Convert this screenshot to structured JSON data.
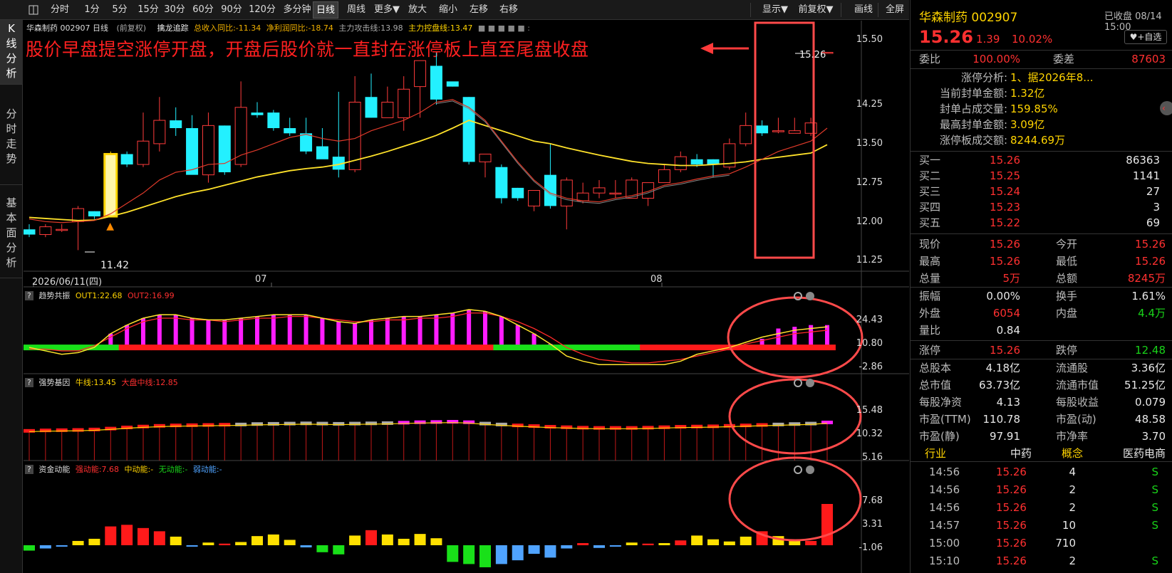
{
  "toolbar": {
    "items": [
      "分时",
      "1分",
      "5分",
      "15分",
      "30分",
      "60分",
      "90分",
      "120分",
      "多分钟",
      "日线",
      "周线",
      "更多▼",
      "放大",
      "缩小",
      "左移",
      "右移"
    ],
    "display": "显示▼",
    "adjust": "前复权▼",
    "draw": "画线",
    "fullscreen": "全屏"
  },
  "sidebar": {
    "tabs": [
      "K\n线\n分\n析",
      "分\n时\n走\n势",
      "基\n本\n面\n分\n析"
    ]
  },
  "main": {
    "header": {
      "title": "华森制药 002907 日线",
      "adj": "(前复权)",
      "indicator": "擒龙追踪",
      "income": "总收入同比:-11.34",
      "profit": "净利润同比:-18.74",
      "attack": "主力攻击线:13.98",
      "control": "主力控盘线:13.47",
      "dots": "■ ■ ■ ■ ■ :"
    },
    "annotation": "股价早盘提空涨停开盘，开盘后股价就一直封在涨停板上直至尾盘收盘",
    "last_price_label": "15.26",
    "low_label": "11.42",
    "yaxis": [
      "15.50",
      "14.25",
      "13.50",
      "12.75",
      "12.00",
      "11.25"
    ],
    "dates": [
      "2026/06/11(四)",
      "07",
      "08"
    ]
  },
  "panels": [
    {
      "q": "?",
      "name": "趋势共振",
      "l1": "OUT1:22.68",
      "l2": "OUT2:16.99",
      "yaxis": [
        "24.43",
        "10.80",
        "-2.86"
      ]
    },
    {
      "q": "?",
      "name": "强势基因",
      "l1": "牛线:13.45",
      "l2": "大盘中线:12.85",
      "yaxis": [
        "15.48",
        "10.32",
        "5.16"
      ]
    },
    {
      "q": "?",
      "name": "资金动能",
      "l1": "强动能:7.68",
      "l2": "中动能:-",
      "l3": "无动能:-",
      "l4": "弱动能:-",
      "yaxis": [
        "7.68",
        "3.31",
        "-1.06"
      ]
    }
  ],
  "right": {
    "name": "华森制药 002907",
    "status": "已收盘 08/14 15:00",
    "price": "15.26",
    "change": "1.39",
    "pct": "10.02%",
    "fav": "+自选",
    "ratio": {
      "l": "委比",
      "v": "100.00%",
      "l2": "委差",
      "v2": "87603"
    },
    "limit": [
      {
        "k": "涨停分析:",
        "v": "1、据2026年8..."
      },
      {
        "k": "当前封单金额:",
        "v": "1.32亿"
      },
      {
        "k": "封单占成交量:",
        "v": "159.85%"
      },
      {
        "k": "最高封单金额:",
        "v": "3.09亿"
      },
      {
        "k": "涨停板成交额:",
        "v": "8244.69万"
      }
    ],
    "bids": [
      {
        "l": "买一",
        "p": "15.26",
        "v": "86363"
      },
      {
        "l": "买二",
        "p": "15.25",
        "v": "1141"
      },
      {
        "l": "买三",
        "p": "15.24",
        "v": "27"
      },
      {
        "l": "买四",
        "p": "15.23",
        "v": "3"
      },
      {
        "l": "买五",
        "p": "15.22",
        "v": "69"
      }
    ],
    "stats1": [
      {
        "a": "现价",
        "b": "15.26",
        "c": "今开",
        "d": "15.26"
      },
      {
        "a": "最高",
        "b": "15.26",
        "c": "最低",
        "d": "15.26"
      },
      {
        "a": "总量",
        "b": "5万",
        "c": "总额",
        "d": "8245万"
      }
    ],
    "stats2": [
      {
        "a": "振幅",
        "b": "0.00%",
        "c": "换手",
        "d": "1.61%"
      },
      {
        "a": "外盘",
        "b": "6054",
        "c": "内盘",
        "d": "4.4万"
      },
      {
        "a": "量比",
        "b": "0.84",
        "c": "",
        "d": ""
      }
    ],
    "stats3": [
      {
        "a": "涨停",
        "b": "15.26",
        "c": "跌停",
        "d": "12.48"
      }
    ],
    "stats4": [
      {
        "a": "总股本",
        "b": "4.18亿",
        "c": "流通股",
        "d": "3.36亿"
      },
      {
        "a": "总市值",
        "b": "63.73亿",
        "c": "流通市值",
        "d": "51.25亿"
      },
      {
        "a": "每股净资",
        "b": "4.13",
        "c": "每股收益",
        "d": "0.079"
      },
      {
        "a": "市盈(TTM)",
        "b": "110.78",
        "c": "市盈(动)",
        "d": "48.58"
      },
      {
        "a": "市盈(静)",
        "b": "97.91",
        "c": "市净率",
        "d": "3.70"
      }
    ],
    "industry": {
      "a": "行业",
      "b": "中药",
      "c": "概念",
      "d": "医药电商"
    },
    "ticks": [
      {
        "t": "14:56",
        "p": "15.26",
        "v": "4",
        "s": "S"
      },
      {
        "t": "14:56",
        "p": "15.26",
        "v": "2",
        "s": "S"
      },
      {
        "t": "14:56",
        "p": "15.26",
        "v": "2",
        "s": "S"
      },
      {
        "t": "14:57",
        "p": "15.26",
        "v": "10",
        "s": "S"
      },
      {
        "t": "15:00",
        "p": "15.26",
        "v": "710",
        "s": ""
      },
      {
        "t": "15:10",
        "p": "15.26",
        "v": "2",
        "s": "S"
      }
    ]
  },
  "chart_data": {
    "type": "candlestick",
    "symbol": "华森制药 002907",
    "ohlc": [
      [
        11.85,
        11.95,
        11.7,
        11.75
      ],
      [
        11.75,
        11.95,
        11.7,
        11.9
      ],
      [
        11.85,
        11.95,
        11.8,
        11.85
      ],
      [
        12.0,
        12.3,
        11.45,
        12.25
      ],
      [
        12.2,
        12.2,
        12.05,
        12.1
      ],
      [
        12.1,
        13.35,
        12.1,
        13.3
      ],
      [
        13.3,
        13.35,
        13.05,
        13.1
      ],
      [
        13.1,
        14.1,
        13.05,
        13.55
      ],
      [
        13.5,
        14.4,
        13.35,
        13.95
      ],
      [
        13.95,
        14.2,
        13.65,
        13.8
      ],
      [
        13.8,
        14.05,
        12.95,
        12.9
      ],
      [
        12.9,
        14.1,
        12.75,
        13.85
      ],
      [
        13.85,
        13.85,
        12.9,
        12.95
      ],
      [
        13.1,
        14.7,
        13.05,
        14.2
      ],
      [
        14.1,
        14.3,
        14.0,
        14.05
      ],
      [
        14.1,
        14.15,
        13.75,
        13.8
      ],
      [
        13.8,
        14.0,
        13.65,
        13.7
      ],
      [
        13.7,
        14.0,
        13.3,
        13.35
      ],
      [
        13.45,
        13.8,
        13.3,
        13.2
      ],
      [
        13.25,
        14.5,
        12.85,
        13.0
      ],
      [
        13.0,
        14.8,
        12.95,
        14.3
      ],
      [
        14.4,
        14.85,
        14.0,
        14.0
      ],
      [
        14.0,
        14.6,
        14.0,
        14.3
      ],
      [
        14.0,
        14.8,
        13.75,
        14.55
      ],
      [
        14.6,
        15.0,
        14.0,
        15.1
      ],
      [
        15.0,
        15.25,
        14.25,
        14.35
      ],
      [
        14.7,
        14.65,
        14.6,
        14.6
      ],
      [
        14.4,
        14.4,
        13.1,
        13.15
      ],
      [
        13.15,
        13.25,
        12.85,
        13.3
      ],
      [
        13.05,
        13.1,
        12.35,
        12.45
      ],
      [
        12.65,
        12.65,
        12.4,
        12.45
      ],
      [
        12.3,
        12.6,
        12.2,
        12.6
      ],
      [
        12.9,
        13.5,
        12.25,
        12.3
      ],
      [
        12.3,
        12.85,
        11.85,
        12.8
      ],
      [
        12.4,
        12.75,
        12.35,
        12.55
      ],
      [
        12.55,
        12.8,
        12.45,
        12.65
      ],
      [
        12.55,
        12.8,
        12.45,
        12.55
      ],
      [
        12.45,
        12.85,
        12.45,
        12.8
      ],
      [
        12.45,
        12.75,
        12.3,
        12.75
      ],
      [
        12.75,
        13.1,
        12.75,
        13.0
      ],
      [
        13.0,
        13.35,
        12.95,
        13.25
      ],
      [
        13.2,
        13.3,
        13.05,
        13.1
      ],
      [
        13.2,
        13.2,
        12.85,
        13.1
      ],
      [
        13.05,
        13.6,
        13.0,
        13.5
      ],
      [
        13.5,
        14.1,
        13.45,
        13.85
      ],
      [
        13.85,
        13.95,
        13.65,
        13.7
      ],
      [
        13.75,
        14.0,
        13.7,
        13.75
      ],
      [
        13.7,
        14.0,
        13.7,
        13.75
      ],
      [
        13.7,
        14.0,
        13.65,
        13.9
      ],
      [
        15.26,
        15.26,
        15.26,
        15.26
      ]
    ],
    "ma_red": [
      12.05,
      12.0,
      11.98,
      12.0,
      12.02,
      12.15,
      12.35,
      12.55,
      12.8,
      12.95,
      13.0,
      13.1,
      13.12,
      13.28,
      13.38,
      13.5,
      13.62,
      13.68,
      13.6,
      13.55,
      13.6,
      13.75,
      13.85,
      13.95,
      14.1,
      14.3,
      14.35,
      14.2,
      13.95,
      13.55,
      13.15,
      12.8,
      12.55,
      12.45,
      12.4,
      12.38,
      12.45,
      12.5,
      12.58,
      12.7,
      12.75,
      12.82,
      12.88,
      12.92,
      13.05,
      13.2,
      13.35,
      13.45,
      13.55,
      13.8
    ],
    "ma_yellow": [
      12.08,
      12.06,
      12.04,
      12.02,
      12.03,
      12.1,
      12.18,
      12.28,
      12.38,
      12.48,
      12.56,
      12.62,
      12.7,
      12.78,
      12.86,
      12.92,
      12.98,
      13.02,
      13.05,
      13.1,
      13.18,
      13.26,
      13.35,
      13.45,
      13.55,
      13.66,
      13.8,
      13.95,
      13.85,
      13.75,
      13.65,
      13.55,
      13.5,
      13.42,
      13.35,
      13.28,
      13.22,
      13.16,
      13.12,
      13.1,
      13.08,
      13.08,
      13.1,
      13.12,
      13.15,
      13.2,
      13.24,
      13.28,
      13.32,
      13.48
    ],
    "trend_bars": [
      0,
      0,
      0,
      0,
      0,
      8,
      13,
      17,
      19,
      19,
      17,
      16,
      16,
      17,
      18,
      19,
      19,
      19,
      17,
      15,
      14,
      16,
      17,
      18,
      18,
      19,
      20,
      22,
      21,
      18,
      13,
      8,
      2,
      0,
      0,
      0,
      0,
      0,
      0,
      0,
      0,
      0,
      0,
      0,
      0,
      5,
      11,
      12,
      13,
      13,
      15,
      21
    ],
    "trend_out1": [
      0,
      -2,
      -4,
      -3,
      0,
      8,
      13,
      17,
      19,
      19,
      17,
      16,
      16,
      17,
      18,
      19,
      19,
      19,
      17,
      15,
      14,
      16,
      17,
      18,
      18,
      19,
      20,
      22,
      21,
      18,
      13,
      8,
      2,
      -5,
      -8,
      -10,
      -10,
      -10,
      -10,
      -10,
      -8,
      -4,
      -2,
      0,
      3,
      6,
      8,
      10,
      11,
      12,
      16,
      22
    ],
    "trend_out2": [
      -1,
      -1,
      -2,
      -2,
      1,
      6,
      11,
      15,
      17,
      17,
      16,
      16,
      15,
      16,
      17,
      17,
      18,
      18,
      17,
      16,
      15,
      15,
      16,
      16,
      17,
      17,
      18,
      20,
      20,
      18,
      15,
      11,
      6,
      0,
      -4,
      -7,
      -8,
      -9,
      -9,
      -8,
      -7,
      -5,
      -3,
      -1,
      2,
      4,
      6,
      8,
      9,
      10,
      12,
      16
    ],
    "strong_gene": [
      11.6,
      11.7,
      11.75,
      11.8,
      11.9,
      12.1,
      12.35,
      12.55,
      12.7,
      12.8,
      12.85,
      12.9,
      12.95,
      13.0,
      13.1,
      13.15,
      13.2,
      13.25,
      13.2,
      13.15,
      13.2,
      13.25,
      13.3,
      13.4,
      13.5,
      13.55,
      13.6,
      13.5,
      13.2,
      13.0,
      12.8,
      12.65,
      12.5,
      12.4,
      12.3,
      12.25,
      12.25,
      12.25,
      12.3,
      12.4,
      12.5,
      12.55,
      12.6,
      12.7,
      12.8,
      12.9,
      13.0,
      13.1,
      13.2,
      13.45
    ],
    "money": [
      -1,
      -0.6,
      -0.1,
      0.8,
      1.2,
      3.5,
      3.8,
      3.2,
      2.6,
      1.6,
      -0.2,
      0.5,
      0.3,
      0.6,
      1.7,
      2.0,
      1.0,
      -0.4,
      -1.3,
      -1.7,
      1.8,
      2.8,
      2.0,
      1.2,
      2.1,
      1.3,
      -3.1,
      -3.5,
      -4.1,
      -3.5,
      -2.8,
      -1.6,
      -2.3,
      -0.6,
      0.4,
      -0.5,
      -0.2,
      0.5,
      0.3,
      0.4,
      0.9,
      1.8,
      1.1,
      0.7,
      1.6,
      2.6,
      1.7,
      1.1,
      0.8,
      7.68
    ]
  }
}
